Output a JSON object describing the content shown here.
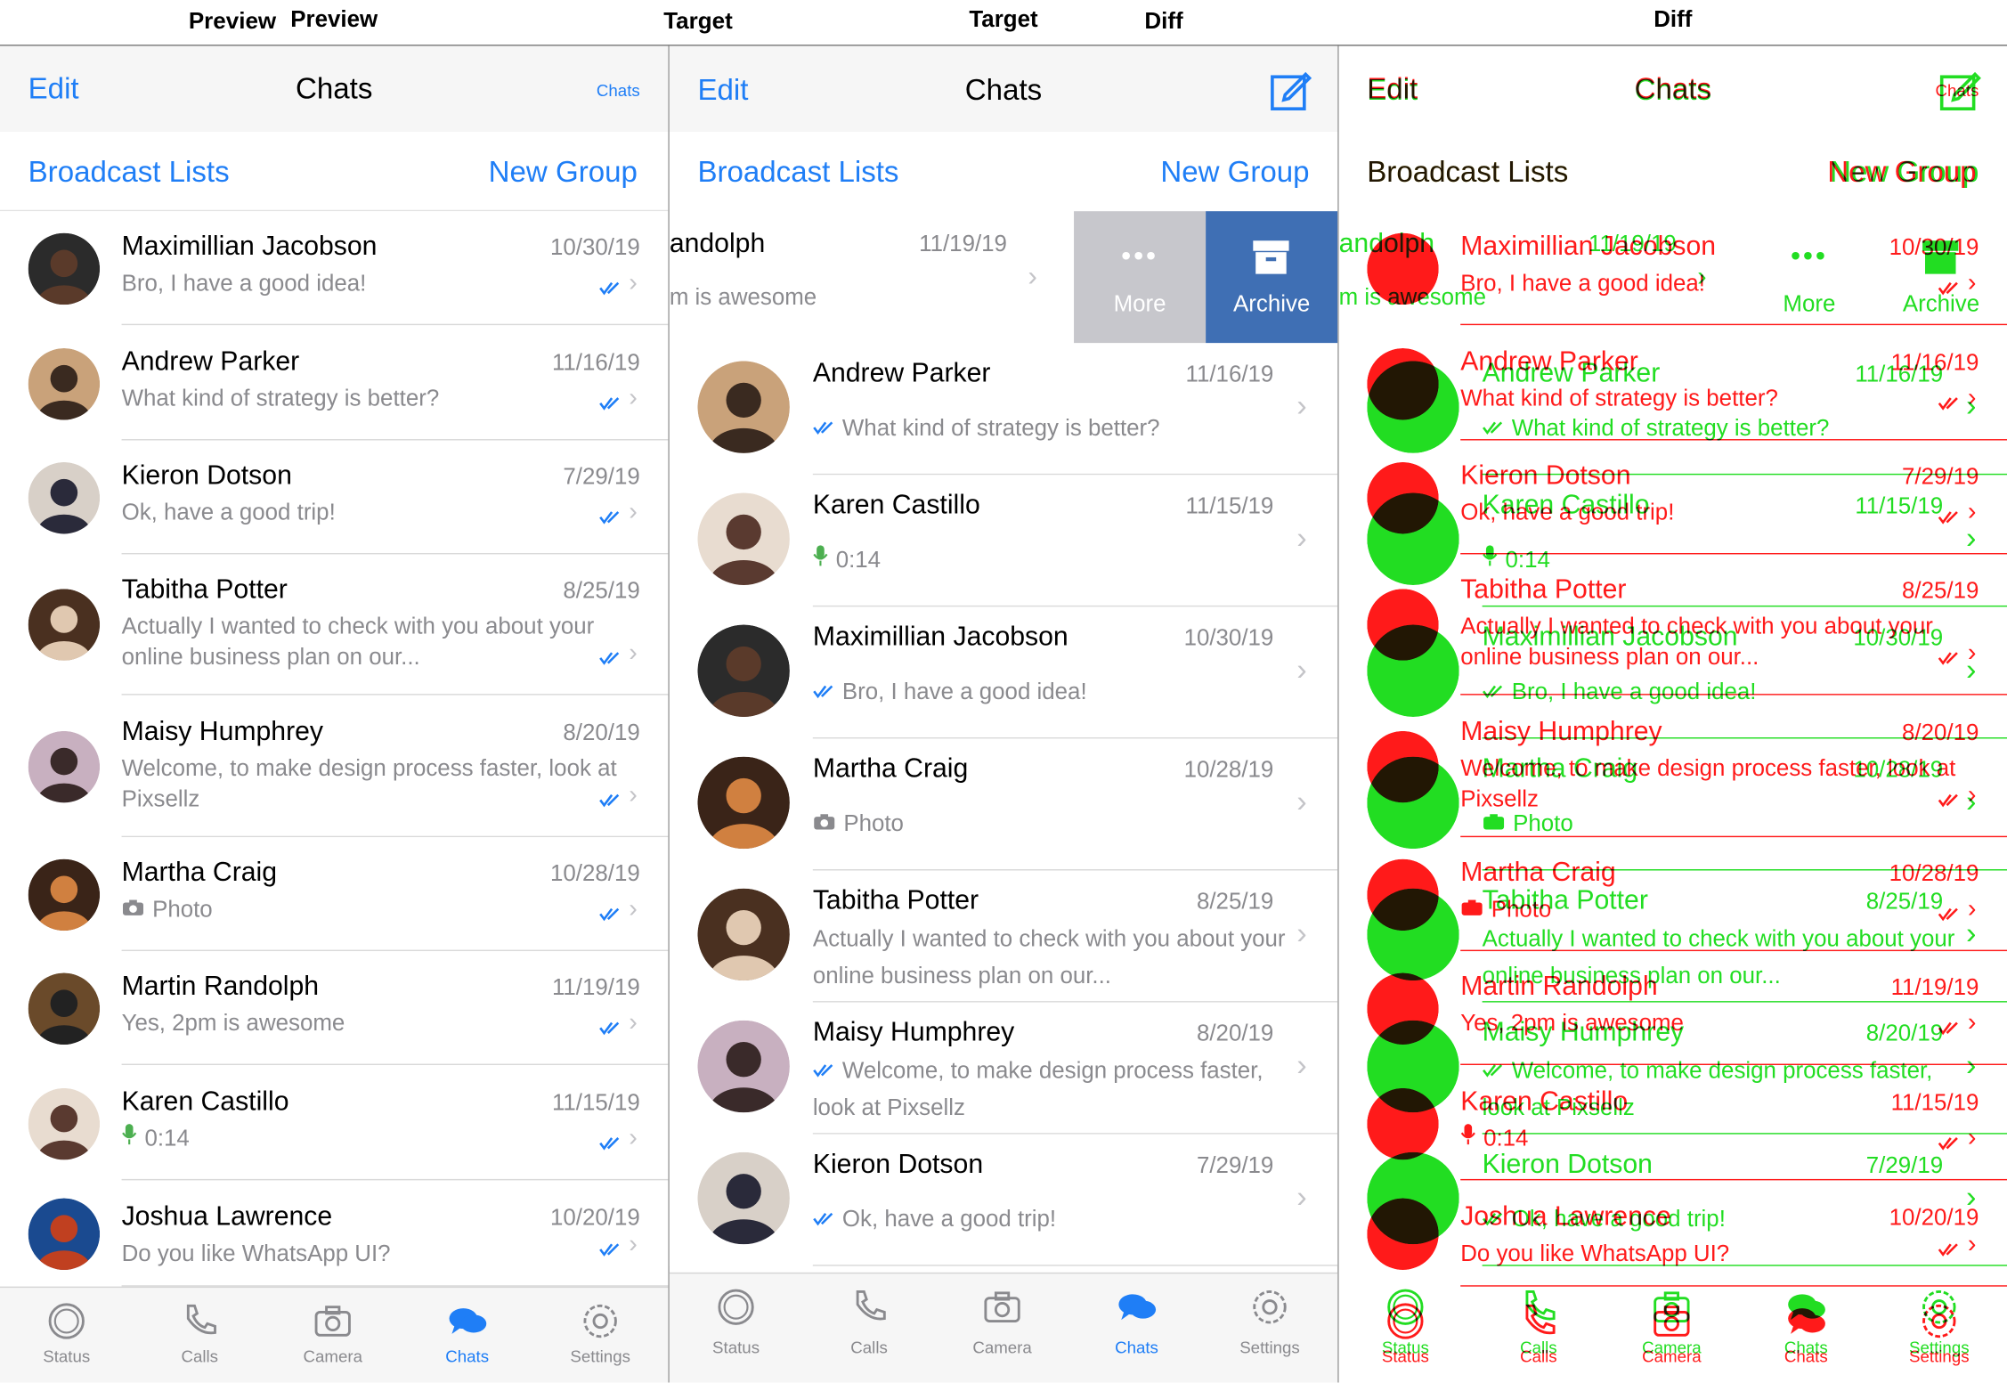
{
  "panel_titles": {
    "preview": "Preview",
    "target": "Target",
    "diff": "Diff"
  },
  "nav": {
    "edit": "Edit",
    "title": "Chats",
    "preview_right": "Chats"
  },
  "lists": {
    "broadcast": "Broadcast Lists",
    "new_group": "New Group"
  },
  "swipe": {
    "more": "More",
    "archive": "Archive"
  },
  "preview_rows": [
    {
      "name": "Maximillian Jacobson",
      "date": "10/30/19",
      "msg": "Bro, I have a good idea!"
    },
    {
      "name": "Andrew Parker",
      "date": "11/16/19",
      "msg": "What kind of strategy is better?"
    },
    {
      "name": "Kieron Dotson",
      "date": "7/29/19",
      "msg": "Ok, have a good trip!"
    },
    {
      "name": "Tabitha Potter",
      "date": "8/25/19",
      "msg": "Actually I wanted to check with you about your online business plan on our..."
    },
    {
      "name": "Maisy Humphrey",
      "date": "8/20/19",
      "msg": "Welcome, to make design process faster, look at Pixsellz"
    },
    {
      "name": "Martha Craig",
      "date": "10/28/19",
      "msg": "Photo"
    },
    {
      "name": "Martin Randolph",
      "date": "11/19/19",
      "msg": "Yes, 2pm is awesome"
    },
    {
      "name": "Karen Castillo",
      "date": "11/15/19",
      "msg": "0:14"
    },
    {
      "name": "Joshua Lawrence",
      "date": "10/20/19",
      "msg": "Do you like WhatsApp UI?"
    }
  ],
  "target_swiped": {
    "name": "andolph",
    "date": "11/19/19",
    "msg": "m is awesome"
  },
  "target_rows": [
    {
      "name": "Andrew Parker",
      "date": "11/16/19",
      "msg": "What kind of strategy is better?"
    },
    {
      "name": "Karen Castillo",
      "date": "11/15/19",
      "msg": "0:14"
    },
    {
      "name": "Maximillian Jacobson",
      "date": "10/30/19",
      "msg": "Bro, I have a good idea!"
    },
    {
      "name": "Martha Craig",
      "date": "10/28/19",
      "msg": "Photo"
    },
    {
      "name": "Tabitha Potter",
      "date": "8/25/19",
      "msg": "Actually I wanted to check with you about your online business plan on our..."
    },
    {
      "name": "Maisy Humphrey",
      "date": "8/20/19",
      "msg": "Welcome, to make design process faster, look at Pixsellz"
    },
    {
      "name": "Kieron Dotson",
      "date": "7/29/19",
      "msg": "Ok, have a good trip!"
    }
  ],
  "tabs": [
    {
      "label": "Status",
      "icon": "status-icon"
    },
    {
      "label": "Calls",
      "icon": "calls-icon"
    },
    {
      "label": "Camera",
      "icon": "camera-icon"
    },
    {
      "label": "Chats",
      "icon": "chats-icon",
      "active": true
    },
    {
      "label": "Settings",
      "icon": "settings-icon"
    }
  ],
  "colors": {
    "accent": "#1f7ef6",
    "archive": "#3f6fb4",
    "more": "#c7c7cc",
    "diff_match": "#22dd22",
    "diff_miss": "#ff1a1a"
  }
}
